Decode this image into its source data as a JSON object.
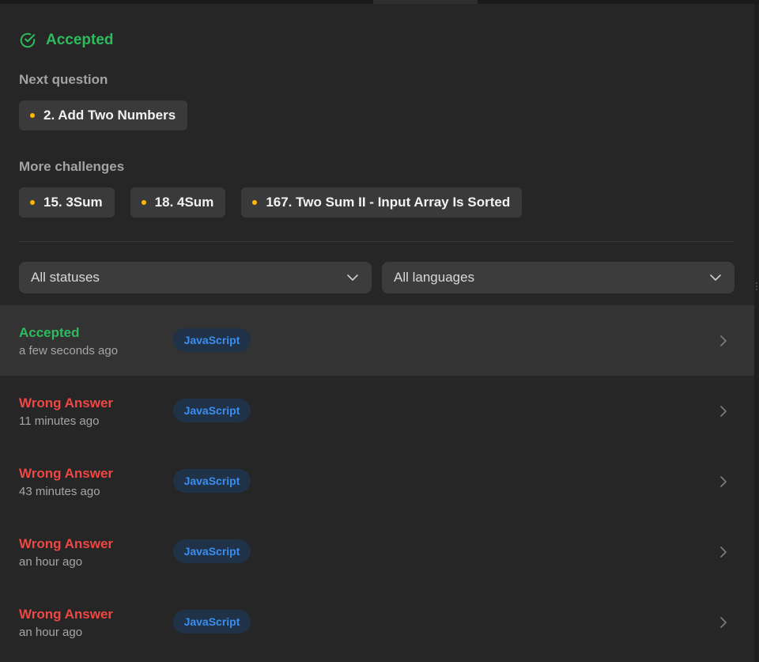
{
  "result": {
    "title": "Accepted",
    "color": "#2cbb5d"
  },
  "next_question": {
    "label": "Next question",
    "items": [
      {
        "title": "2. Add Two Numbers",
        "difficulty_color": "#ffb800"
      }
    ]
  },
  "more_challenges": {
    "label": "More challenges",
    "items": [
      {
        "title": "15. 3Sum",
        "difficulty_color": "#ffb800"
      },
      {
        "title": "18. 4Sum",
        "difficulty_color": "#ffb800"
      },
      {
        "title": "167. Two Sum II - Input Array Is Sorted",
        "difficulty_color": "#ffb800"
      }
    ]
  },
  "filters": {
    "status": "All statuses",
    "language": "All languages"
  },
  "submissions": [
    {
      "status": "Accepted",
      "time": "a few seconds ago",
      "language": "JavaScript",
      "status_color": "#2cbb5d"
    },
    {
      "status": "Wrong Answer",
      "time": "11 minutes ago",
      "language": "JavaScript",
      "status_color": "#ef4743"
    },
    {
      "status": "Wrong Answer",
      "time": "43 minutes ago",
      "language": "JavaScript",
      "status_color": "#ef4743"
    },
    {
      "status": "Wrong Answer",
      "time": "an hour ago",
      "language": "JavaScript",
      "status_color": "#ef4743"
    },
    {
      "status": "Wrong Answer",
      "time": "an hour ago",
      "language": "JavaScript",
      "status_color": "#ef4743"
    }
  ],
  "icons": {
    "result": "check-circle-icon",
    "difficulty": "dot-icon",
    "dropdown": "chevron-down-icon",
    "row_open": "chevron-right-icon"
  }
}
